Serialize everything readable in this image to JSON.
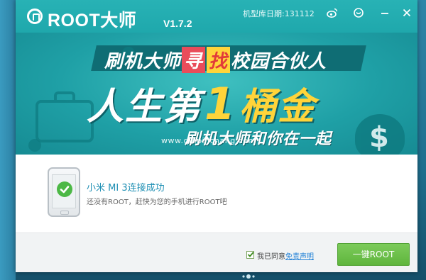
{
  "window": {
    "title": "ROOT大师",
    "version": "V1.7.2",
    "db_date_label": "机型库日期:131112"
  },
  "titlebar_buttons": [
    {
      "name": "weibo",
      "icon": "weibo-icon"
    },
    {
      "name": "feedback",
      "icon": "feedback-icon"
    },
    {
      "name": "minimize",
      "icon": "minimize-icon"
    },
    {
      "name": "close",
      "icon": "close-icon"
    }
  ],
  "banner": {
    "line1_prefix": "刷机大师",
    "line1_red": "寻",
    "line1_yellow": "找",
    "line1_suffix": "校园合伙人",
    "line2_prefix": "人生第",
    "line2_number": "1",
    "line2_suffix": "桶金",
    "line3": "刷机大师和你在一起",
    "watermark": "www.qinpinchang.com",
    "dollar_sign": "$"
  },
  "device": {
    "status": "小米 MI 3连接成功",
    "hint": "还没有ROOT，赶快为您的手机进行ROOT吧"
  },
  "footer": {
    "agree_text": "我已同意",
    "disclaimer_link": "免责声明",
    "agree_checked": true,
    "root_button_label": "一键ROOT"
  },
  "colors": {
    "titlebar": "#1fa8ac",
    "banner": "#1fa0a6",
    "highlight_red": "#e94c5a",
    "highlight_yellow": "#ffd43a",
    "status_text": "#1e8fb4",
    "root_button": "#5fb53d",
    "link": "#1e7fd6"
  }
}
